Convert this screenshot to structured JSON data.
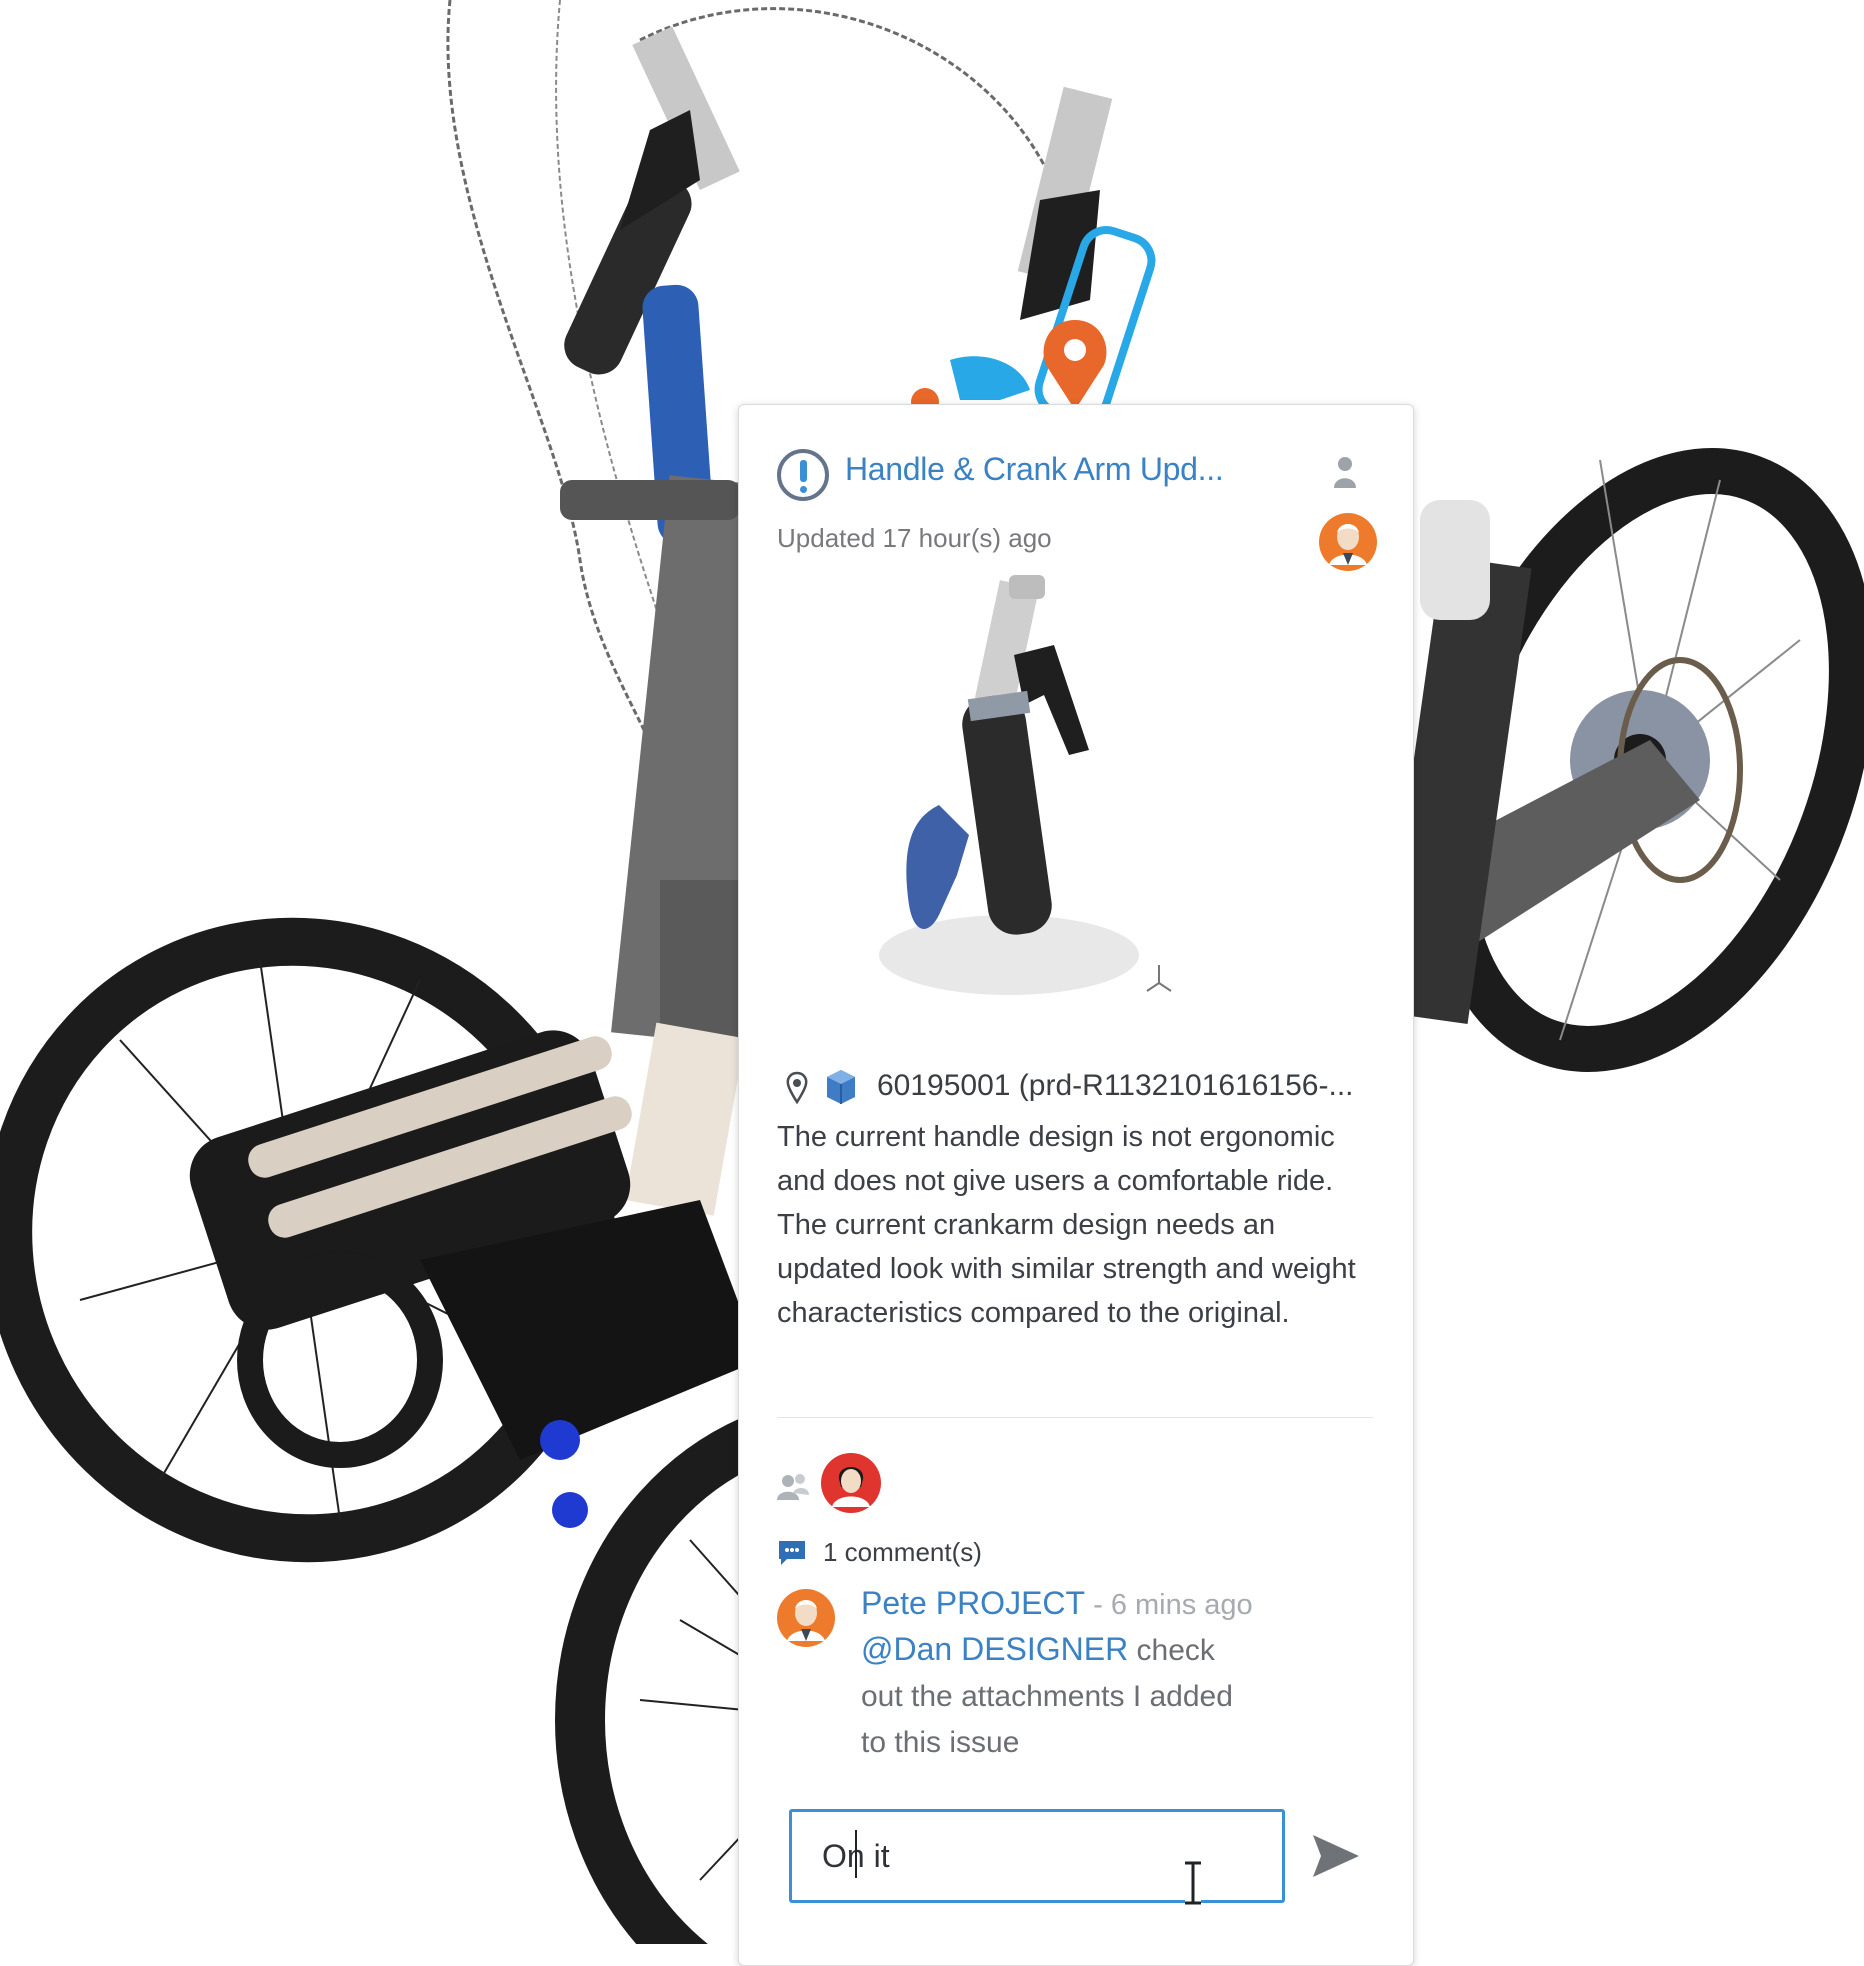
{
  "issue": {
    "title": "Handle & Crank Arm Upd...",
    "updated": "Updated 17 hour(s) ago",
    "part_reference": "60195001 (prd-R1132101616156-...",
    "description": "The current handle design is not ergonomic and does not give users a comfortable ride. The current crankarm design needs an updated look with similar strength and weight characteristics compared to the original."
  },
  "comments": {
    "count_label": "1 comment(s)",
    "items": [
      {
        "author": "Pete PROJECT",
        "time": " - 6 mins ago",
        "mention": "@Dan DESIGNER",
        "text_after_mention": " check",
        "line2": "out the attachments I added",
        "line3": "to this issue"
      }
    ]
  },
  "reply": {
    "value": "On it"
  },
  "icons": {
    "issue": "issue-alert-icon",
    "owner": "user-icon",
    "location": "location-pin-icon",
    "part": "3d-part-icon",
    "assignees": "group-icon",
    "comments": "comment-icon",
    "send": "send-icon"
  },
  "colors": {
    "accent": "#3b82c4",
    "avatar_orange": "#ee7b2b",
    "avatar_red": "#e0342f",
    "marker_orange": "#e8672a",
    "highlight_blue": "#28a8e6"
  }
}
